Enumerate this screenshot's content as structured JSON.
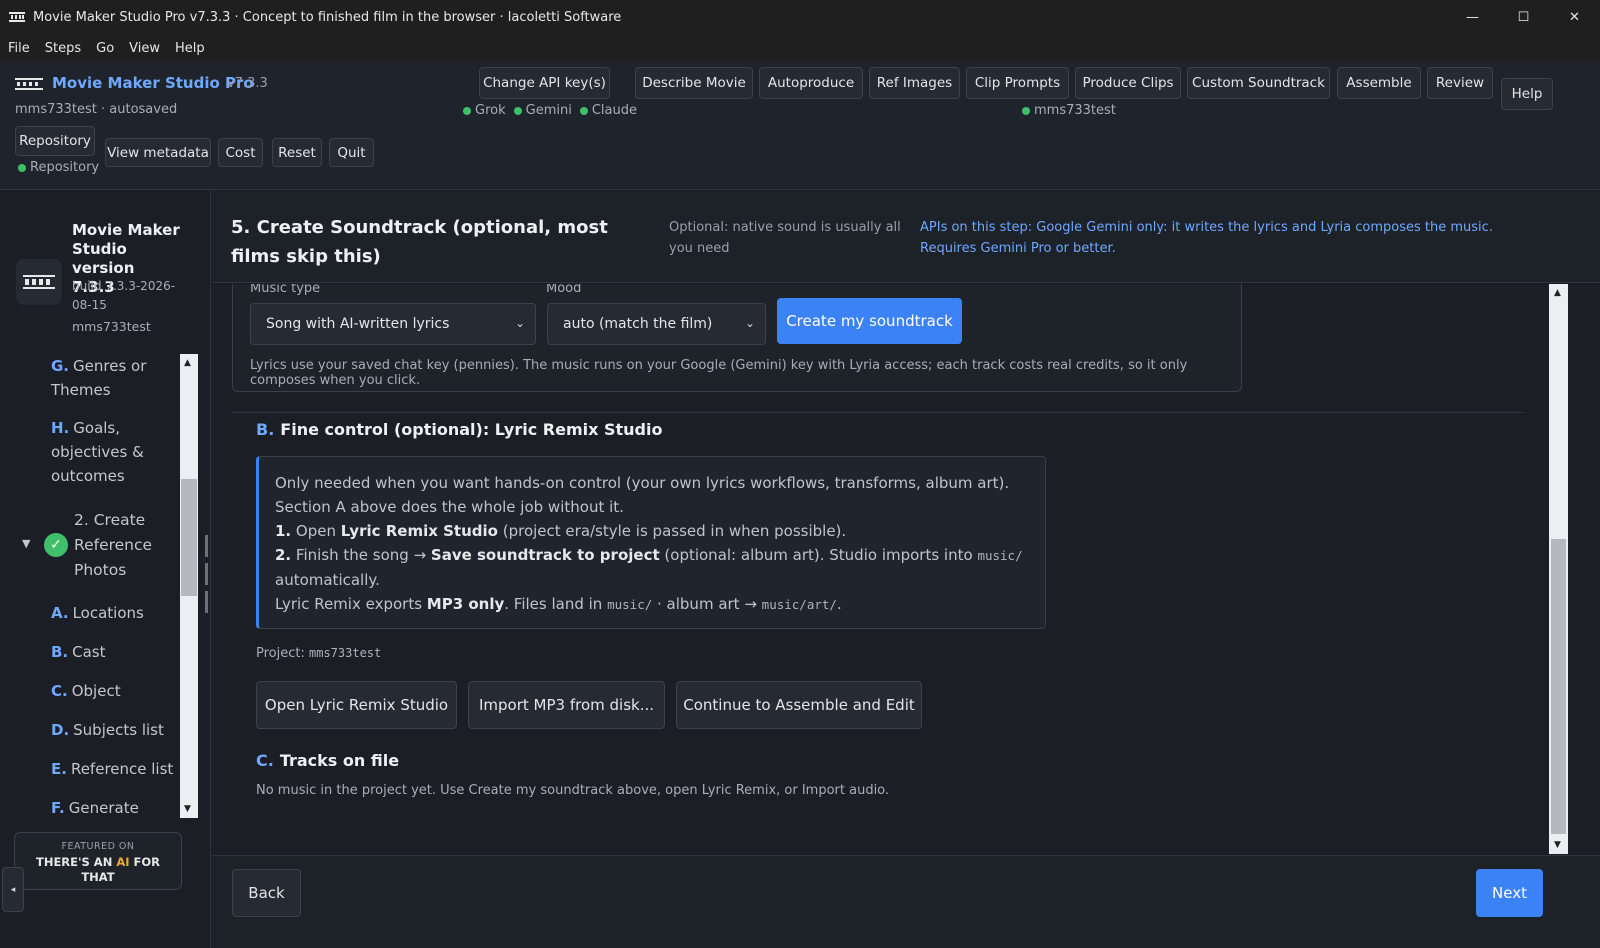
{
  "window": {
    "title": "Movie Maker Studio Pro v7.3.3 · Concept to finished film in the browser · lacoletti Software",
    "controls": {
      "minimize": "—",
      "maximize": "☐",
      "close": "✕"
    }
  },
  "menu": [
    "File",
    "Steps",
    "Go",
    "View",
    "Help"
  ],
  "header": {
    "brand_name": "Movie Maker Studio Pro",
    "version": "v7.3.3",
    "project_status": "mms733test · autosaved",
    "api_key_button": "Change API key(s)",
    "api_status": [
      "Grok",
      "Gemini",
      "Claude"
    ],
    "steps": [
      "Describe Movie",
      "Autoproduce",
      "Ref Images",
      "Clip Prompts",
      "Produce Clips",
      "Custom Soundtrack",
      "Assemble",
      "Review"
    ],
    "step_project": "mms733test",
    "help": "Help",
    "repository_button": "Repository",
    "repository_status": "Repository",
    "actions": [
      "View metadata",
      "Cost",
      "Reset",
      "Quit"
    ]
  },
  "sidebar": {
    "title": "Movie Maker Studio version 7.3.3",
    "build": "build 7.3.3-2026-08-15",
    "user": "mms733test",
    "items": [
      {
        "letter": "G.",
        "label": "Genres or Themes"
      },
      {
        "letter": "H.",
        "label": "Goals, objectives & outcomes"
      },
      {
        "letter": "",
        "label": "2. Create Reference Photos",
        "completed": true,
        "expanded": true
      },
      {
        "letter": "A.",
        "label": "Locations"
      },
      {
        "letter": "B.",
        "label": "Cast"
      },
      {
        "letter": "C.",
        "label": "Object"
      },
      {
        "letter": "D.",
        "label": "Subjects list"
      },
      {
        "letter": "E.",
        "label": "Reference list"
      },
      {
        "letter": "F.",
        "label": "Generate"
      }
    ],
    "featured": {
      "line1": "FEATURED ON",
      "line2_pre": "THERE'S AN ",
      "line2_ai": "AI",
      "line2_post": " FOR THAT"
    }
  },
  "step": {
    "title": "5. Create Soundtrack (optional, most films skip this)",
    "hint": "Optional: native sound is usually all you need",
    "apis": "APIs on this step: Google Gemini only: it writes the lyrics and Lyria composes the music. Requires Gemini Pro or better."
  },
  "section_a": {
    "music_type_label": "Music type",
    "music_type_value": "Song with AI-written lyrics",
    "mood_label": "Mood",
    "mood_value": "auto (match the film)",
    "create_button": "Create my soundtrack",
    "note": "Lyrics use your saved chat key (pennies). The music runs on your Google (Gemini) key with Lyria access; each track costs real credits, so it only composes when you click."
  },
  "section_b": {
    "letter": "B.",
    "title": "Fine control (optional): Lyric Remix Studio",
    "intro": "Only needed when you want hands-on control (your own lyrics workflows, transforms, album art). Section A above does the whole job without it.",
    "step1_num": "1.",
    "step1_pre": "Open ",
    "step1_bold": "Lyric Remix Studio",
    "step1_post": " (project era/style is passed in when possible).",
    "step2_num": "2.",
    "step2_pre": "Finish the song → ",
    "step2_bold": "Save soundtrack to project",
    "step2_mid": " (optional: album art). Studio imports into ",
    "step2_code": "music/",
    "step2_post": " automatically.",
    "export_pre": "Lyric Remix exports ",
    "export_bold": "MP3 only",
    "export_mid": ". Files land in ",
    "export_code1": "music/",
    "export_mid2": " · album art → ",
    "export_code2": "music/art/",
    "export_post": ".",
    "project_label": "Project:",
    "project_value": "mms733test",
    "buttons": [
      "Open Lyric Remix Studio",
      "Import MP3 from disk...",
      "Continue to Assemble and Edit"
    ]
  },
  "section_c": {
    "letter": "C.",
    "title": "Tracks on file",
    "note": "No music in the project yet. Use Create my soundtrack above, open Lyric Remix, or Import audio."
  },
  "footer": {
    "back": "Back",
    "next": "Next"
  },
  "colors": {
    "accent": "#3b82f6",
    "link": "#6fa8ff",
    "status_ok": "#3fbf6a",
    "featured_ai": "#f0a93b"
  }
}
